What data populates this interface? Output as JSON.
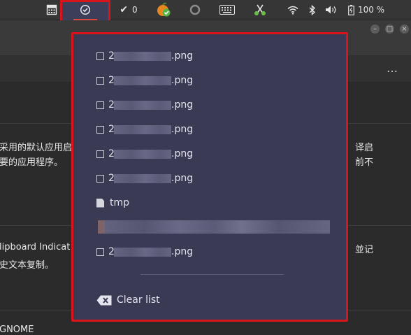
{
  "panel": {
    "checkmark_count": "0",
    "battery_percent": "100 %"
  },
  "background": {
    "line1_left": "采用的默认应用启",
    "line1_right": "译启",
    "line2_left": "要的应用程序。",
    "line2_right": "前不",
    "line3_left": "lipboard Indicat",
    "line3_right": "並记",
    "line4_left": "史文本复制。",
    "line5": "GNOME"
  },
  "clipboard_menu": {
    "items": [
      {
        "type": "image",
        "suffix": ".png",
        "prefix": "2"
      },
      {
        "type": "image",
        "suffix": ".png",
        "prefix": "2"
      },
      {
        "type": "image",
        "suffix": ".png",
        "prefix": "2"
      },
      {
        "type": "image",
        "suffix": ".png",
        "prefix": "2"
      },
      {
        "type": "image",
        "suffix": ".png",
        "prefix": "2"
      },
      {
        "type": "image",
        "suffix": ".png",
        "prefix": "2"
      },
      {
        "type": "file",
        "label": "tmp"
      },
      {
        "type": "text",
        "label": ""
      },
      {
        "type": "image",
        "suffix": ".png",
        "prefix": "2"
      }
    ],
    "clear_label": "Clear list"
  },
  "colors": {
    "popup_bg": "#3a3a55",
    "highlight": "#d9141b",
    "panel_bg": "#363636"
  },
  "icons": [
    "calculator-icon",
    "clock-icon",
    "check-icon",
    "fruit-app-icon",
    "circle-icon",
    "keyboard-icon",
    "scissors-icon",
    "wifi-icon",
    "bluetooth-icon",
    "volume-icon",
    "battery-icon"
  ]
}
